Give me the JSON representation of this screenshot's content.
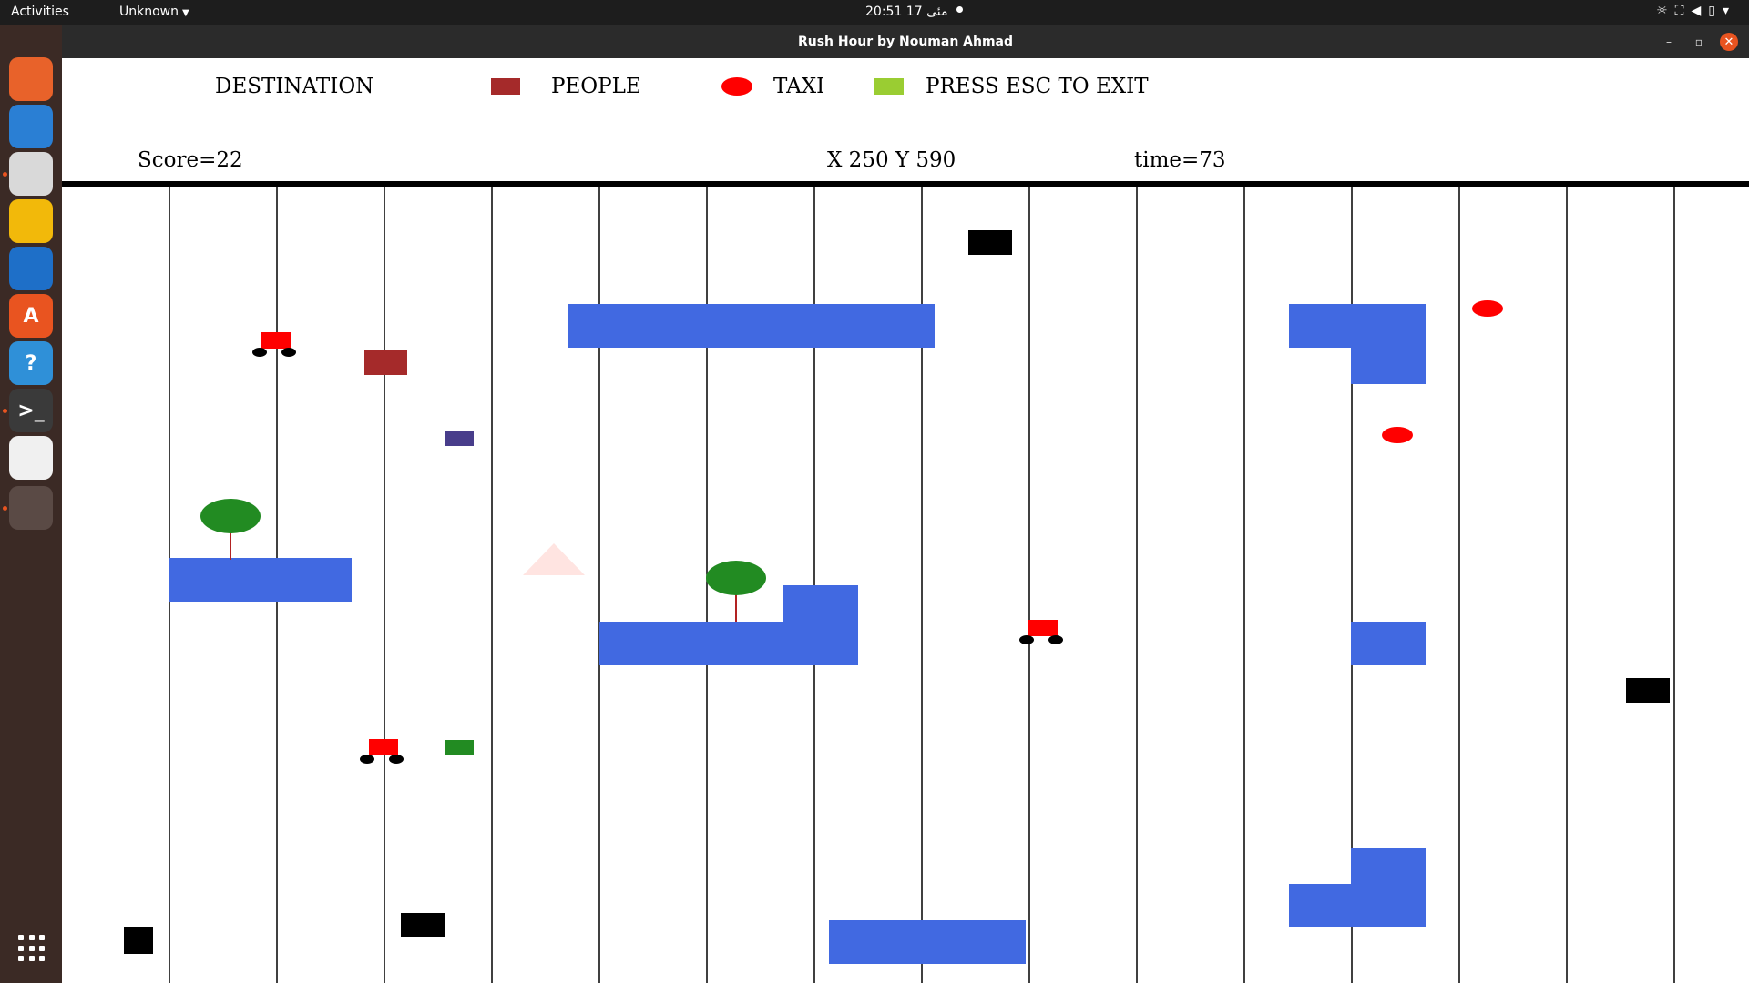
{
  "topbar": {
    "activities": "Activities",
    "app_menu": "Unknown",
    "clock": "20:51  17 مئی"
  },
  "dock": {
    "items": [
      {
        "name": "firefox-icon",
        "color": "#e8622a",
        "glyph": ""
      },
      {
        "name": "thunderbird-icon",
        "color": "#2a7fd4",
        "glyph": ""
      },
      {
        "name": "files-icon",
        "color": "#d9d9d9",
        "glyph": ""
      },
      {
        "name": "rhythmbox-icon",
        "color": "#f2b90a",
        "glyph": ""
      },
      {
        "name": "writer-icon",
        "color": "#1e6fc8",
        "glyph": ""
      },
      {
        "name": "software-icon",
        "color": "#e95420",
        "glyph": "A"
      },
      {
        "name": "help-icon",
        "color": "#2f90d8",
        "glyph": "?"
      },
      {
        "name": "terminal-icon",
        "color": "#3a3a3a",
        "glyph": ">_"
      },
      {
        "name": "text-editor-icon",
        "color": "#f0f0f0",
        "glyph": ""
      },
      {
        "name": "game-window-icon",
        "color": "#5a4a45",
        "glyph": ""
      }
    ],
    "apps_grid": "apps-grid-icon"
  },
  "window": {
    "title": "Rush Hour by Nouman Ahmad"
  },
  "game": {
    "legend": {
      "destination": "DESTINATION",
      "people": "PEOPLE",
      "taxi": "TAXI",
      "exit": "PRESS ESC TO EXIT"
    },
    "hud": {
      "score": "Score=22",
      "position": "X 250 Y 590",
      "time": "time=73"
    },
    "colors": {
      "people": "#a52a2a",
      "taxi": "#ff0000",
      "destination": "#9acd32",
      "building": "#4169e1",
      "obstacle": "#000000",
      "tree": "#228b22",
      "car": "#ff0000",
      "passenger_drop": "#483d8b",
      "box_green": "#228b22",
      "gridline": "#000000",
      "triangle": "#ffe4e1"
    }
  }
}
